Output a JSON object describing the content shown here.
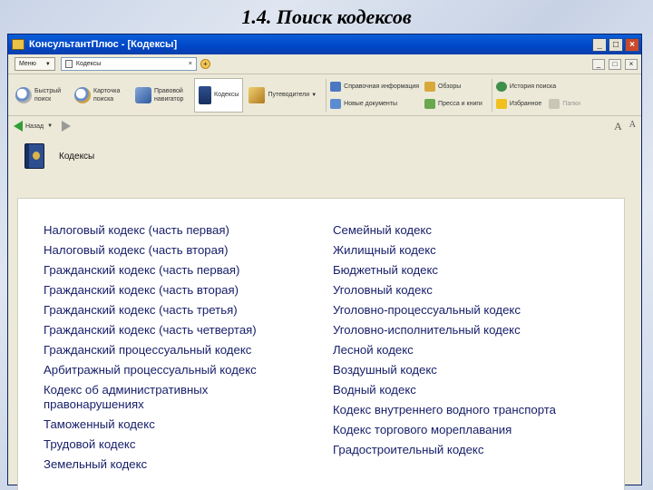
{
  "slide_title": "1.4. Поиск кодексов",
  "window": {
    "title": "КонсультантПлюс - [Кодексы]",
    "controls": [
      "_",
      "□",
      "×"
    ]
  },
  "addressbar": {
    "menu_label": "Меню",
    "tab_label": "Кодексы"
  },
  "toolbar": {
    "buttons": [
      {
        "label": "Быстрый поиск",
        "icon": "search-icon"
      },
      {
        "label": "Карточка поиска",
        "icon": "search-card-icon"
      },
      {
        "label": "Правовой навигатор",
        "icon": "legal-navigator-icon"
      },
      {
        "label": "Кодексы",
        "icon": "codes-book-icon"
      },
      {
        "label": "Путеводители",
        "icon": "guide-icon"
      }
    ],
    "small": [
      {
        "label": "Справочная информация",
        "icon": "info-icon"
      },
      {
        "label": "Обзоры",
        "icon": "pen-icon"
      },
      {
        "label": "Новые документы",
        "icon": "new-docs-icon"
      },
      {
        "label": "Пресса и книги",
        "icon": "press-icon"
      },
      {
        "label": "История поиска",
        "icon": "history-icon"
      },
      {
        "label": "Избранное",
        "icon": "star-icon"
      },
      {
        "label": "Папки",
        "icon": "folders-icon"
      }
    ]
  },
  "nav": {
    "back_label": "Назад",
    "font_controls": [
      "A",
      "A"
    ]
  },
  "content": {
    "heading": "Кодексы",
    "left_codes": [
      "Налоговый кодекс (часть первая)",
      "Налоговый кодекс (часть вторая)",
      "Гражданский кодекс (часть первая)",
      "Гражданский кодекс (часть вторая)",
      "Гражданский кодекс (часть третья)",
      "Гражданский кодекс (часть четвертая)",
      "Гражданский процессуальный кодекс",
      "Арбитражный процессуальный кодекс",
      "Кодекс об административных правонарушениях",
      "Таможенный кодекс",
      "Трудовой кодекс",
      "Земельный кодекс"
    ],
    "right_codes": [
      "Семейный кодекс",
      "Жилищный кодекс",
      "Бюджетный кодекс",
      "Уголовный кодекс",
      "Уголовно-процессуальный кодекс",
      "Уголовно-исполнительный кодекс",
      "Лесной кодекс",
      "Воздушный кодекс",
      "Водный кодекс",
      "Кодекс внутреннего водного транспорта",
      "Кодекс торгового мореплавания",
      "Градостроительный кодекс"
    ]
  }
}
